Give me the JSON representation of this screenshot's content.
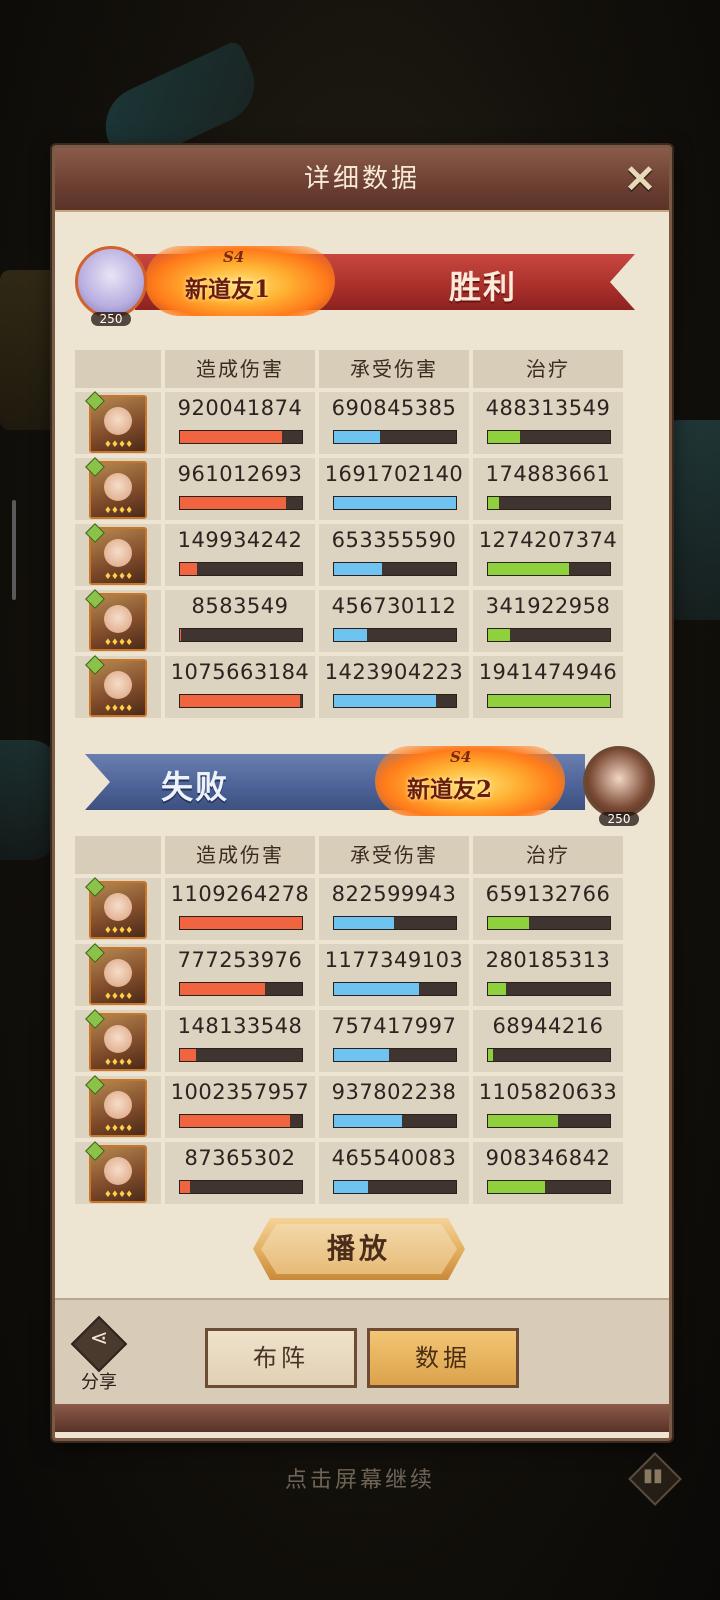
{
  "dialog": {
    "title": "详细数据",
    "close_icon": "close-icon"
  },
  "columns": {
    "blank": "",
    "damage_dealt": "造成伤害",
    "damage_taken": "承受伤害",
    "healing": "治疗"
  },
  "team1": {
    "season": "S4",
    "player_name": "新道友1",
    "result": "胜利",
    "avatar_level": "250",
    "rows": [
      {
        "damage_dealt": "920041874",
        "damage_taken": "690845385",
        "healing": "488313549",
        "dmg_frac": 0.84,
        "tak_frac": 0.38,
        "heal_frac": 0.26
      },
      {
        "damage_dealt": "961012693",
        "damage_taken": "1691702140",
        "healing": "174883661",
        "dmg_frac": 0.87,
        "tak_frac": 1.0,
        "heal_frac": 0.09
      },
      {
        "damage_dealt": "149934242",
        "damage_taken": "653355590",
        "healing": "1274207374",
        "dmg_frac": 0.14,
        "tak_frac": 0.39,
        "heal_frac": 0.66
      },
      {
        "damage_dealt": "8583549",
        "damage_taken": "456730112",
        "healing": "341922958",
        "dmg_frac": 0.01,
        "tak_frac": 0.27,
        "heal_frac": 0.18
      },
      {
        "damage_dealt": "1075663184",
        "damage_taken": "1423904223",
        "healing": "1941474946",
        "dmg_frac": 0.98,
        "tak_frac": 0.84,
        "heal_frac": 1.0
      }
    ]
  },
  "team2": {
    "season": "S4",
    "player_name": "新道友2",
    "result": "失败",
    "avatar_level": "250",
    "rows": [
      {
        "damage_dealt": "1109264278",
        "damage_taken": "822599943",
        "healing": "659132766",
        "dmg_frac": 1.0,
        "tak_frac": 0.49,
        "heal_frac": 0.34
      },
      {
        "damage_dealt": "777253976",
        "damage_taken": "1177349103",
        "healing": "280185313",
        "dmg_frac": 0.7,
        "tak_frac": 0.7,
        "heal_frac": 0.15
      },
      {
        "damage_dealt": "148133548",
        "damage_taken": "757417997",
        "healing": "68944216",
        "dmg_frac": 0.13,
        "tak_frac": 0.45,
        "heal_frac": 0.04
      },
      {
        "damage_dealt": "1002357957",
        "damage_taken": "937802238",
        "healing": "1105820633",
        "dmg_frac": 0.9,
        "tak_frac": 0.56,
        "heal_frac": 0.57
      },
      {
        "damage_dealt": "87365302",
        "damage_taken": "465540083",
        "healing": "908346842",
        "dmg_frac": 0.08,
        "tak_frac": 0.28,
        "heal_frac": 0.47
      }
    ]
  },
  "hero_icon_stars": "♦♦♦♦",
  "buttons": {
    "play": "播放",
    "lineup": "布阵",
    "data": "数据",
    "share": "分享"
  },
  "icons": {
    "share": "share-icon",
    "stats": "bar-chart-icon"
  },
  "hint": "点击屏幕继续",
  "colors": {
    "damage": "#f0643f",
    "taken": "#6ec3f0",
    "heal": "#8fd13d",
    "win": "#a82f2b",
    "lose": "#4c6296"
  }
}
